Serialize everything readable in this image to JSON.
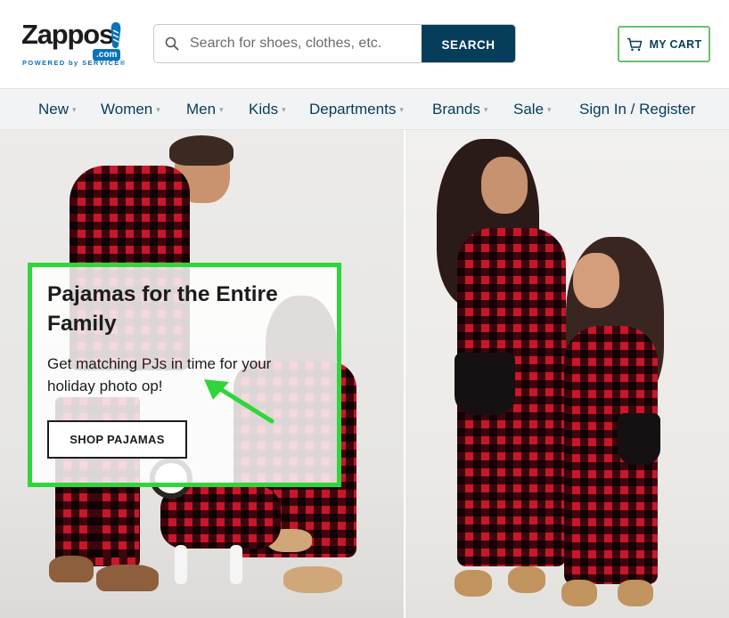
{
  "header": {
    "logo": {
      "wordmark": "Zappos",
      "com": ".com",
      "tagline": "POWERED by SERVICE®"
    },
    "search": {
      "placeholder": "Search for shoes, clothes, etc.",
      "button_label": "SEARCH"
    },
    "cart_label": "MY CART"
  },
  "nav": {
    "items": [
      {
        "label": "New"
      },
      {
        "label": "Women"
      },
      {
        "label": "Men"
      },
      {
        "label": "Kids"
      },
      {
        "label": "Departments"
      },
      {
        "label": "Brands"
      },
      {
        "label": "Sale"
      },
      {
        "label": "Sign In / Register"
      }
    ]
  },
  "promo": {
    "title": "Pajamas for the Entire Family",
    "subtitle": "Get matching PJs in time for your holiday photo op!",
    "button_label": "SHOP PAJAMAS",
    "highlight_color": "#2fd63a"
  },
  "colors": {
    "brand_navy": "#063d5b",
    "brand_blue": "#0a72b8",
    "cart_border": "#6ac26a",
    "plaid_red": "#c8172a"
  },
  "icons": [
    "search-icon",
    "cart-icon",
    "chevron-down-icon",
    "arrow-icon"
  ]
}
